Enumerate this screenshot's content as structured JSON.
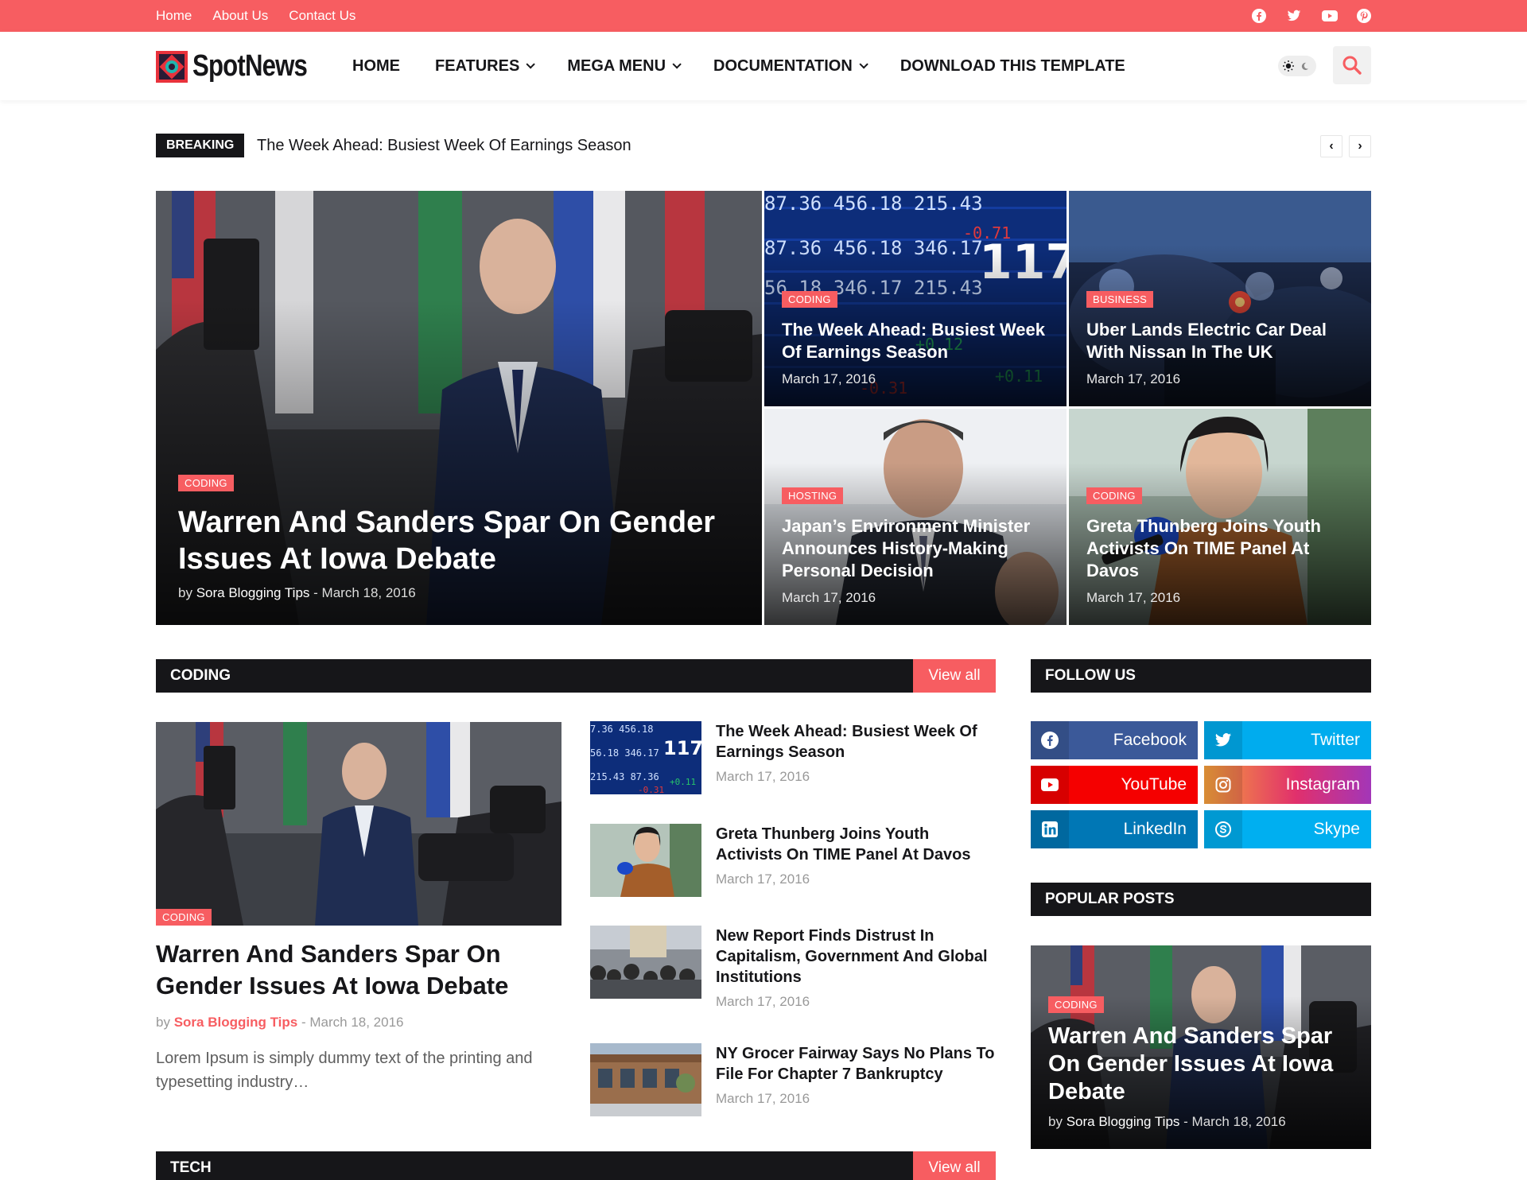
{
  "topbar": {
    "links": [
      "Home",
      "About Us",
      "Contact Us"
    ],
    "social_icons": [
      "facebook-icon",
      "twitter-icon",
      "youtube-icon",
      "pinterest-icon"
    ]
  },
  "header": {
    "logo_text": "SpotNews",
    "nav": [
      {
        "label": "HOME",
        "dropdown": false
      },
      {
        "label": "FEATURES",
        "dropdown": true
      },
      {
        "label": "MEGA MENU",
        "dropdown": true
      },
      {
        "label": "DOCUMENTATION",
        "dropdown": true
      },
      {
        "label": "DOWNLOAD THIS TEMPLATE",
        "dropdown": false
      }
    ]
  },
  "breaking": {
    "tag": "BREAKING",
    "headline": "The Week Ahead: Busiest Week Of Earnings Season"
  },
  "featured": {
    "big": {
      "category": "CODING",
      "title": "Warren And Sanders Spar On Gender Issues At Iowa Debate",
      "by": "by",
      "author": "Sora Blogging Tips",
      "sep": "-",
      "date": "March 18, 2016"
    },
    "small": [
      {
        "category": "CODING",
        "title": "The Week Ahead: Busiest Week Of Earnings Season",
        "date": "March 17, 2016"
      },
      {
        "category": "BUSINESS",
        "title": "Uber Lands Electric Car Deal With Nissan In The UK",
        "date": "March 17, 2016"
      },
      {
        "category": "HOSTING",
        "title": "Japan’s Environment Minister Announces History-Making Personal Decision",
        "date": "March 17, 2016"
      },
      {
        "category": "CODING",
        "title": "Greta Thunberg Joins Youth Activists On TIME Panel At Davos",
        "date": "March 17, 2016"
      }
    ]
  },
  "coding": {
    "heading": "CODING",
    "view_all": "View all",
    "main": {
      "category": "CODING",
      "title": "Warren And Sanders Spar On Gender Issues At Iowa Debate",
      "by": "by",
      "author": "Sora Blogging Tips",
      "sep": "-",
      "date": "March 18, 2016",
      "snippet": "Lorem Ipsum is simply dummy text of the printing and typesetting industry…"
    },
    "list": [
      {
        "title": "The Week Ahead: Busiest Week Of Earnings Season",
        "date": "March 17, 2016"
      },
      {
        "title": "Greta Thunberg Joins Youth Activists On TIME Panel At Davos",
        "date": "March 17, 2016"
      },
      {
        "title": "New Report Finds Distrust In Capitalism, Government And Global Institutions",
        "date": "March 17, 2016"
      },
      {
        "title": "NY Grocer Fairway Says No Plans To File For Chapter 7 Bankruptcy",
        "date": "March 17, 2016"
      }
    ]
  },
  "tech": {
    "heading": "TECH",
    "view_all": "View all"
  },
  "sidebar": {
    "follow_heading": "FOLLOW US",
    "social": [
      {
        "name": "Facebook",
        "icon": "facebook-icon",
        "color": "#3b5999"
      },
      {
        "name": "Twitter",
        "icon": "twitter-icon",
        "color": "#00acee"
      },
      {
        "name": "YouTube",
        "icon": "youtube-icon",
        "color": "#f50000"
      },
      {
        "name": "Instagram",
        "icon": "instagram-icon",
        "color": "#c13584"
      },
      {
        "name": "LinkedIn",
        "icon": "linkedin-icon",
        "color": "#0077b5"
      },
      {
        "name": "Skype",
        "icon": "skype-icon",
        "color": "#00aff0"
      }
    ],
    "popular_heading": "POPULAR POSTS",
    "popular": {
      "category": "CODING",
      "title": "Warren And Sanders Spar On Gender Issues At Iowa Debate",
      "by": "by",
      "author": "Sora Blogging Tips",
      "sep": "-",
      "date": "March 18, 2016"
    }
  },
  "colors": {
    "accent": "#f75d61",
    "dark": "#161619"
  }
}
